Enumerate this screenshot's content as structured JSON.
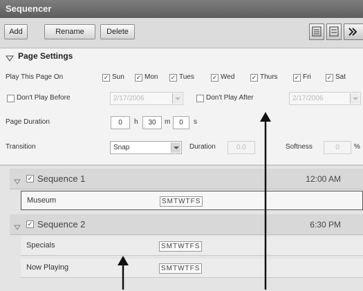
{
  "window": {
    "title": "Sequencer"
  },
  "toolbar": {
    "add_label": "Add",
    "rename_label": "Rename",
    "delete_label": "Delete",
    "icons": [
      "list-view-icon",
      "detail-view-icon",
      "expand-right-icon"
    ]
  },
  "page_settings": {
    "heading": "Page Settings",
    "play_on_label": "Play This Page On",
    "days": [
      {
        "label": "Sun",
        "checked": true
      },
      {
        "label": "Mon",
        "checked": true
      },
      {
        "label": "Tues",
        "checked": true
      },
      {
        "label": "Wed",
        "checked": true
      },
      {
        "label": "Thurs",
        "checked": true
      },
      {
        "label": "Fri",
        "checked": true
      },
      {
        "label": "Sat",
        "checked": true
      }
    ],
    "dont_play_before_label": "Don't Play Before",
    "dont_play_before_value": "2/17/2006",
    "dont_play_after_label": "Don't Play After",
    "dont_play_after_value": "2/17/2006",
    "page_duration_label": "Page Duration",
    "duration_h": "0",
    "h_unit": "h",
    "duration_m": "30",
    "m_unit": "m",
    "duration_s": "0",
    "s_unit": "s",
    "transition_label": "Transition",
    "transition_value": "Snap",
    "transition_duration_label": "Duration",
    "transition_duration_value": "0.0",
    "softness_label": "Softness",
    "softness_value": "0",
    "softness_unit": "%"
  },
  "sequences": [
    {
      "name": "Sequence 1",
      "time": "12:00 AM",
      "checked": true,
      "pages": [
        {
          "name": "Museum",
          "days": "SMTWTFS",
          "selected": true
        }
      ]
    },
    {
      "name": "Sequence 2",
      "time": "6:30 PM",
      "checked": true,
      "pages": [
        {
          "name": "Specials",
          "days": "SMTWTFS",
          "selected": false
        },
        {
          "name": "Now Playing",
          "days": "SMTWTFS",
          "selected": false
        }
      ]
    }
  ]
}
